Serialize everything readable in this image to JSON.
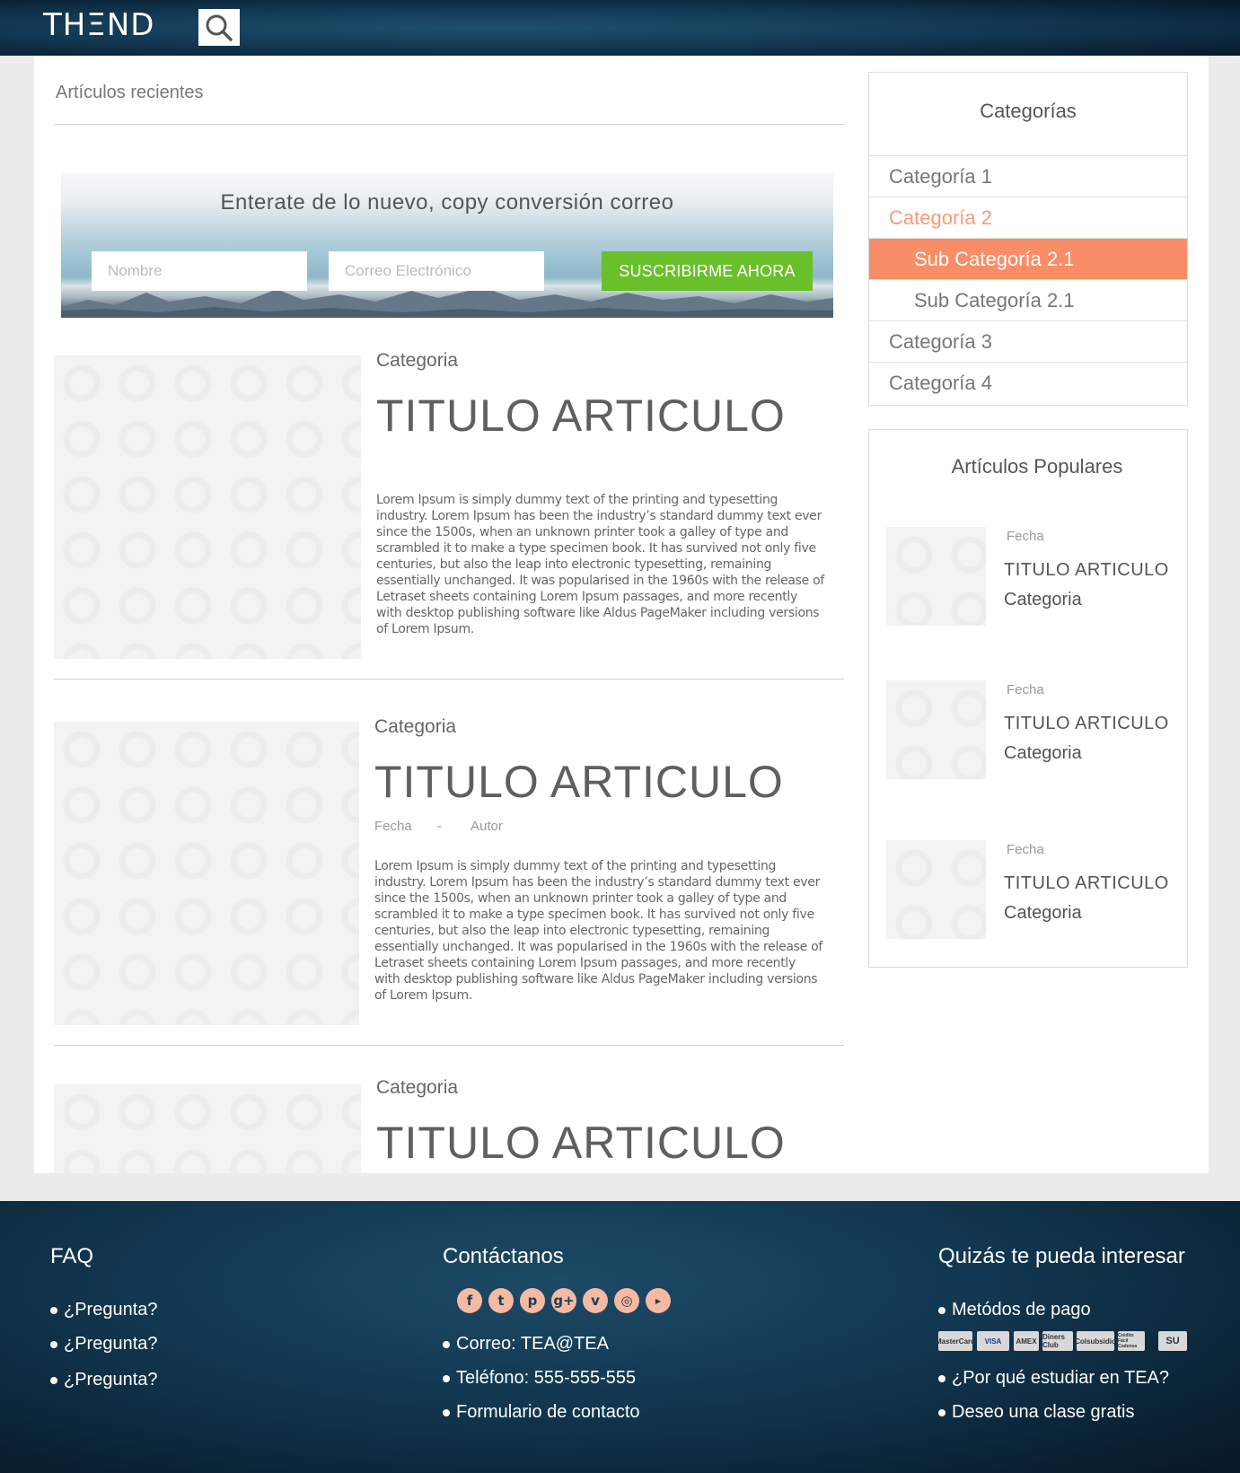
{
  "header": {
    "logo": "THΞND"
  },
  "main": {
    "section_title": "Artículos recientes",
    "newsletter": {
      "title": "Enterate de lo nuevo, copy conversión correo",
      "name_placeholder": "Nombre",
      "email_placeholder": "Correo Electrónico",
      "button": "SUSCRIBIRME AHORA"
    },
    "articles": [
      {
        "category": "Categoria",
        "title": "TITULO ARTICULO",
        "body": "Lorem Ipsum is simply dummy text of the printing and typesetting industry. Lorem Ipsum has been the industry’s standard dummy text ever since the 1500s, when an unknown printer took a galley of type and scrambled it to make a type specimen book. It has survived not only five centuries, but also the leap into electronic typesetting, remaining essentially unchanged. It was popularised in the 1960s with the release of Letraset sheets containing Lorem Ipsum passages, and more recently with desktop publishing software like Aldus PageMaker including versions of Lorem Ipsum."
      },
      {
        "category": "Categoria",
        "title": "TITULO ARTICULO",
        "date": "Fecha",
        "separator": "-",
        "author": "Autor",
        "body": "Lorem Ipsum is simply dummy text of the printing and typesetting industry. Lorem Ipsum has been the industry’s standard dummy text ever since the 1500s, when an unknown printer took a galley of type and scrambled it to make a type specimen book. It has survived not only five centuries, but also the leap into electronic typesetting, remaining essentially unchanged. It was popularised in the 1960s with the release of Letraset sheets containing Lorem Ipsum passages, and more recently with desktop publishing software like Aldus PageMaker including versions of Lorem Ipsum."
      },
      {
        "category": "Categoria",
        "title": "TITULO ARTICULO"
      }
    ]
  },
  "sidebar": {
    "categories_title": "Categorías",
    "categories": [
      "Categoría 1",
      "Categoría 2",
      "Sub Categoría 2.1",
      "Sub Categoría 2.1",
      "Categoría 3",
      "Categoría 4"
    ],
    "popular_title": "Artículos Populares",
    "popular": [
      {
        "date": "Fecha",
        "title": "TITULO ARTICULO",
        "category": "Categoria"
      },
      {
        "date": "Fecha",
        "title": "TITULO ARTICULO",
        "category": "Categoria"
      },
      {
        "date": "Fecha",
        "title": "TITULO ARTICULO",
        "category": "Categoria"
      }
    ]
  },
  "footer": {
    "faq_title": "FAQ",
    "faq": [
      "¿Pregunta?",
      "¿Pregunta?",
      "¿Pregunta?"
    ],
    "contact_title": "Contáctanos",
    "social_icons": [
      "facebook-icon",
      "twitter-icon",
      "pinterest-icon",
      "google-plus-icon",
      "vimeo-icon",
      "instagram-icon",
      "youtube-icon"
    ],
    "contact": [
      "Correo: TEA@TEA",
      "Teléfono: 555-555-555",
      "Formulario de contacto"
    ],
    "interest_title": "Quizás te pueda interesar",
    "interest": [
      "Metódos de pago",
      "¿Por qué estudiar en TEA?",
      "Deseo una clase gratis"
    ],
    "payment_cards": [
      "MasterCard",
      "VISA",
      "AMEX",
      "Diners Club",
      "Colsubsidio",
      "Crédito Fácil Codensa",
      "SU"
    ]
  },
  "colors": {
    "accent": "#f98d67",
    "accent_text": "#f89a7a",
    "subscribe_green": "#6ac02a",
    "header_dark": "#123752"
  }
}
